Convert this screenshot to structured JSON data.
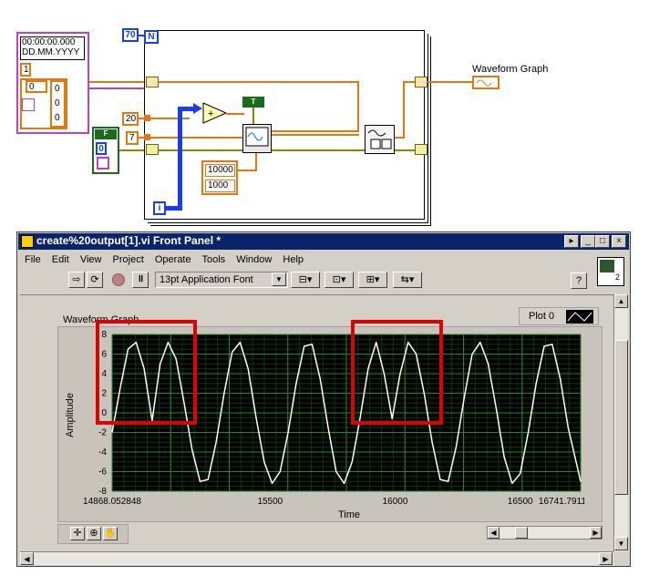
{
  "diagram": {
    "loop_count": "70",
    "loop_count_terminal": "N",
    "iteration_terminal": "i",
    "timestamp_line1": "00:00:00.000",
    "timestamp_line2": "DD.MM.YYYY",
    "cluster_value_1": "1",
    "cluster_array_index": "0",
    "cluster_array_values": [
      "0",
      "0",
      "0"
    ],
    "const_20": "20",
    "const_7": "7",
    "bool_array_index": "0",
    "const_10000": "10000",
    "const_1000": "1000",
    "bool_true_label": "T",
    "bool_false_label": "F",
    "graph_terminal_label": "Waveform Graph"
  },
  "window": {
    "title": "create%20output[1].vi Front Panel *",
    "menu": [
      "File",
      "Edit",
      "View",
      "Project",
      "Operate",
      "Tools",
      "Window",
      "Help"
    ],
    "font_selector": "13pt Application Font",
    "help_button": "?",
    "connector_label": "2"
  },
  "graph": {
    "title": "Waveform Graph",
    "legend_label": "Plot 0",
    "xlabel": "Time",
    "ylabel": "Amplitude",
    "x_ticks": [
      "14868.052848",
      "15500",
      "16000",
      "16500",
      "16741.7911"
    ],
    "y_ticks": [
      "8",
      "6",
      "4",
      "2",
      "0",
      "-2",
      "-4",
      "-6",
      "-8"
    ]
  },
  "chart_data": {
    "type": "line",
    "title": "Waveform Graph",
    "xlabel": "Time",
    "ylabel": "Amplitude",
    "xlim": [
      14868.052848,
      16741.7911
    ],
    "ylim": [
      -8,
      8
    ],
    "grid": true,
    "legend": "top-right",
    "series": [
      {
        "name": "Plot 0",
        "x": [
          14868.05,
          14900,
          14932,
          14964,
          14996,
          15028,
          15060,
          15092,
          15124,
          15156,
          15188,
          15220,
          15252,
          15284,
          15316,
          15348,
          15380,
          15412,
          15444,
          15476,
          15508,
          15540,
          15572,
          15604,
          15636,
          15668,
          15700,
          15732,
          15764,
          15796,
          15828,
          15860,
          15892,
          15924,
          15956,
          15988,
          16020,
          16052,
          16084,
          16116,
          16148,
          16180,
          16212,
          16244,
          16276,
          16308,
          16340,
          16372,
          16404,
          16436,
          16468,
          16500,
          16532,
          16564,
          16596,
          16628,
          16660,
          16692,
          16741.79
        ],
        "y": [
          -2.0,
          2.5,
          6.5,
          7.2,
          4.5,
          -0.8,
          5.0,
          7.2,
          5.5,
          1.0,
          -3.8,
          -7.0,
          -6.8,
          -3.0,
          2.0,
          6.2,
          7.2,
          4.5,
          -0.5,
          -5.0,
          -7.2,
          -6.0,
          -2.0,
          3.0,
          6.8,
          7.0,
          3.5,
          -1.5,
          -6.0,
          -7.2,
          -5.0,
          -0.5,
          4.5,
          7.2,
          4.0,
          -0.6,
          4.0,
          7.2,
          6.0,
          2.0,
          -3.0,
          -6.8,
          -7.0,
          -3.5,
          1.5,
          6.0,
          7.2,
          5.0,
          0.5,
          -4.5,
          -7.2,
          -6.2,
          -2.0,
          3.0,
          6.8,
          7.0,
          3.5,
          -1.5,
          -7.0
        ]
      }
    ]
  }
}
